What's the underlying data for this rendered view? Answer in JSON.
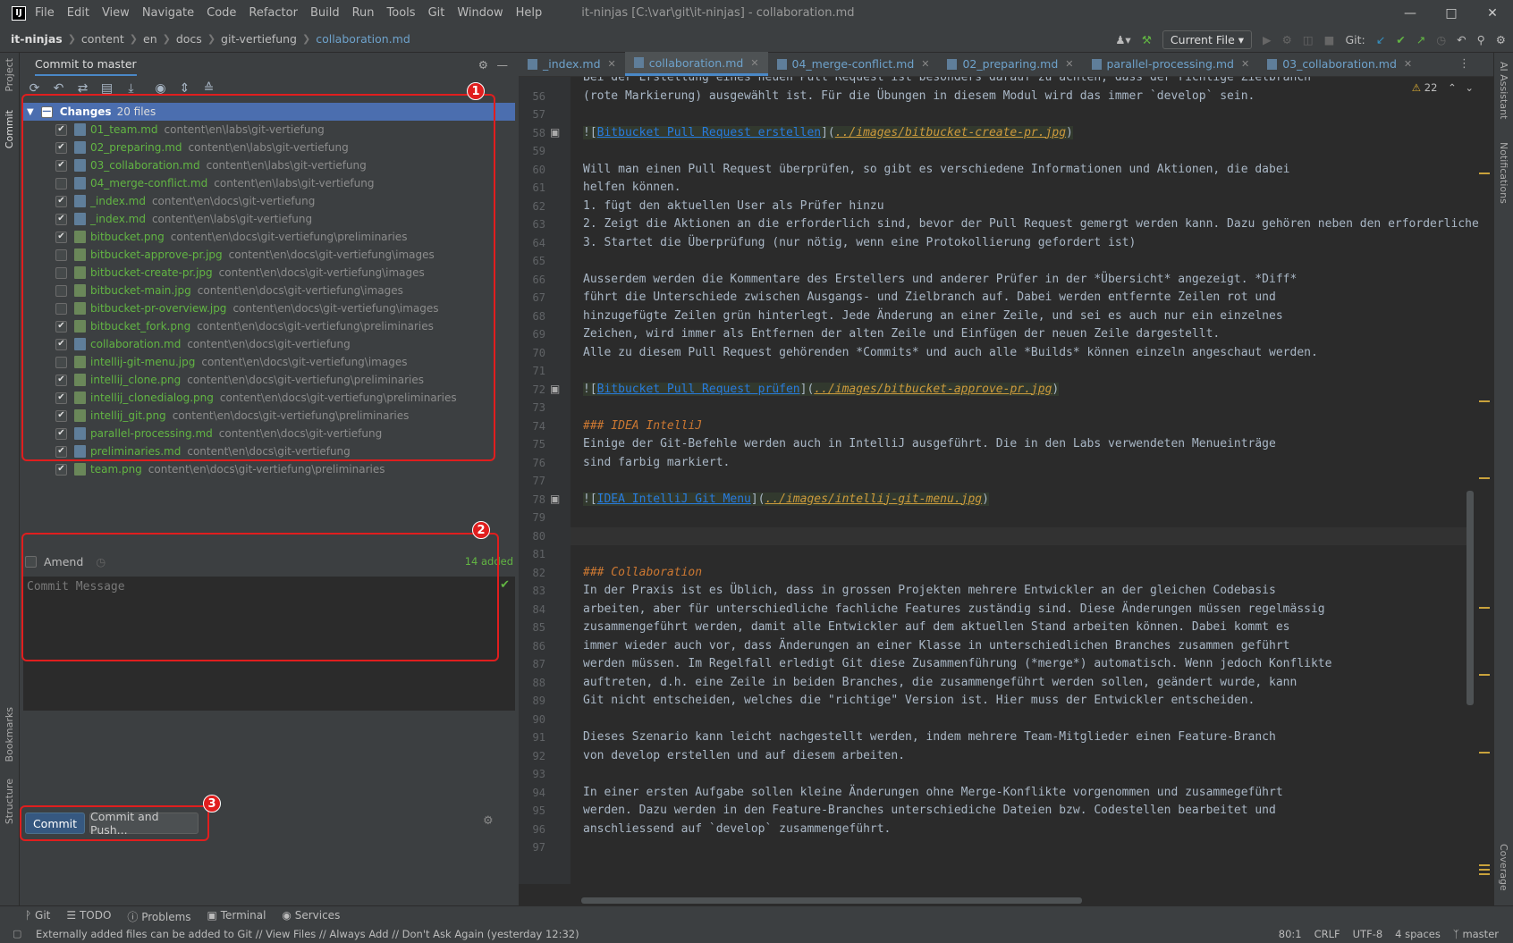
{
  "titlebar": {
    "logo": "IJ",
    "menu": [
      "File",
      "Edit",
      "View",
      "Navigate",
      "Code",
      "Refactor",
      "Build",
      "Run",
      "Tools",
      "Git",
      "Window",
      "Help"
    ],
    "title": "it-ninjas [C:\\var\\git\\it-ninjas] - collaboration.md"
  },
  "breadcrumbs": [
    "it-ninjas",
    "content",
    "en",
    "docs",
    "git-vertiefung",
    "collaboration.md"
  ],
  "toolbar": {
    "current_file": "Current File",
    "git_label": "Git:"
  },
  "left_strip": {
    "project": "Project",
    "commit": "Commit",
    "bookmarks": "Bookmarks",
    "structure": "Structure"
  },
  "right_strip": {
    "ai": "AI Assistant",
    "notifications": "Notifications",
    "coverage": "Coverage"
  },
  "commit_panel": {
    "title": "Commit to master",
    "changes_label": "Changes",
    "changes_count": "20 files",
    "files": [
      {
        "name": "01_team.md",
        "path": "content\\en\\labs\\git-vertiefung",
        "checked": true,
        "kind": "md"
      },
      {
        "name": "02_preparing.md",
        "path": "content\\en\\labs\\git-vertiefung",
        "checked": true,
        "kind": "md"
      },
      {
        "name": "03_collaboration.md",
        "path": "content\\en\\labs\\git-vertiefung",
        "checked": true,
        "kind": "md"
      },
      {
        "name": "04_merge-conflict.md",
        "path": "content\\en\\labs\\git-vertiefung",
        "checked": false,
        "kind": "md"
      },
      {
        "name": "_index.md",
        "path": "content\\en\\docs\\git-vertiefung",
        "checked": true,
        "kind": "md"
      },
      {
        "name": "_index.md",
        "path": "content\\en\\labs\\git-vertiefung",
        "checked": true,
        "kind": "md"
      },
      {
        "name": "bitbucket.png",
        "path": "content\\en\\docs\\git-vertiefung\\preliminaries",
        "checked": true,
        "kind": "img"
      },
      {
        "name": "bitbucket-approve-pr.jpg",
        "path": "content\\en\\docs\\git-vertiefung\\images",
        "checked": false,
        "kind": "img"
      },
      {
        "name": "bitbucket-create-pr.jpg",
        "path": "content\\en\\docs\\git-vertiefung\\images",
        "checked": false,
        "kind": "img"
      },
      {
        "name": "bitbucket-main.jpg",
        "path": "content\\en\\docs\\git-vertiefung\\images",
        "checked": false,
        "kind": "img"
      },
      {
        "name": "bitbucket-pr-overview.jpg",
        "path": "content\\en\\docs\\git-vertiefung\\images",
        "checked": false,
        "kind": "img"
      },
      {
        "name": "bitbucket_fork.png",
        "path": "content\\en\\docs\\git-vertiefung\\preliminaries",
        "checked": true,
        "kind": "img"
      },
      {
        "name": "collaboration.md",
        "path": "content\\en\\docs\\git-vertiefung",
        "checked": true,
        "kind": "md"
      },
      {
        "name": "intellij-git-menu.jpg",
        "path": "content\\en\\docs\\git-vertiefung\\images",
        "checked": false,
        "kind": "img"
      },
      {
        "name": "intellij_clone.png",
        "path": "content\\en\\docs\\git-vertiefung\\preliminaries",
        "checked": true,
        "kind": "img"
      },
      {
        "name": "intellij_clonedialog.png",
        "path": "content\\en\\docs\\git-vertiefung\\preliminaries",
        "checked": true,
        "kind": "img"
      },
      {
        "name": "intellij_git.png",
        "path": "content\\en\\docs\\git-vertiefung\\preliminaries",
        "checked": true,
        "kind": "img"
      },
      {
        "name": "parallel-processing.md",
        "path": "content\\en\\docs\\git-vertiefung",
        "checked": true,
        "kind": "md"
      },
      {
        "name": "preliminaries.md",
        "path": "content\\en\\docs\\git-vertiefung",
        "checked": true,
        "kind": "md"
      },
      {
        "name": "team.png",
        "path": "content\\en\\docs\\git-vertiefung\\preliminaries",
        "checked": true,
        "kind": "img"
      }
    ],
    "amend_label": "Amend",
    "added_info": "14 added",
    "message_placeholder": "Commit Message",
    "commit_button": "Commit",
    "commit_push_button": "Commit and Push...",
    "annotations": [
      "1",
      "2",
      "3"
    ]
  },
  "editor": {
    "tabs": [
      {
        "label": "_index.md",
        "active": false
      },
      {
        "label": "collaboration.md",
        "active": true
      },
      {
        "label": "04_merge-conflict.md",
        "active": false
      },
      {
        "label": "02_preparing.md",
        "active": false
      },
      {
        "label": "parallel-processing.md",
        "active": false
      },
      {
        "label": "03_collaboration.md",
        "active": false
      }
    ],
    "warnings": "22",
    "lines": [
      {
        "n": "",
        "t": "Bei der Erstellung eines neuen Pull Request ist besonders darauf zu achten, dass der richtige Zielbranch"
      },
      {
        "n": "56",
        "t": "(rote Markierung) ausgewählt ist. Für die Übungen in diesem Modul wird das immer `develop` sein."
      },
      {
        "n": "57",
        "t": ""
      },
      {
        "n": "58",
        "t": "![Bitbucket Pull Request erstellen](../images/bitbucket-create-pr.jpg)",
        "img": true,
        "alt": "Bitbucket Pull Request erstellen",
        "link": "../images/bitbucket-create-pr.jpg"
      },
      {
        "n": "59",
        "t": ""
      },
      {
        "n": "60",
        "t": "Will man einen Pull Request überprüfen, so gibt es verschiedene Informationen und Aktionen, die dabei"
      },
      {
        "n": "61",
        "t": "helfen können."
      },
      {
        "n": "62",
        "t": "1. fügt den aktuellen User als Prüfer hinzu"
      },
      {
        "n": "63",
        "t": "2. Zeigt die Aktionen an die erforderlich sind, bevor der Pull Request gemergt werden kann. Dazu gehören neben den erforderliche"
      },
      {
        "n": "64",
        "t": "3. Startet die Überprüfung (nur nötig, wenn eine Protokollierung gefordert ist)"
      },
      {
        "n": "65",
        "t": ""
      },
      {
        "n": "66",
        "t": "Ausserdem werden die Kommentare des Erstellers und anderer Prüfer in der *Übersicht* angezeigt. *Diff*"
      },
      {
        "n": "67",
        "t": "führt die Unterschiede zwischen Ausgangs- und Zielbranch auf. Dabei werden entfernte Zeilen rot und"
      },
      {
        "n": "68",
        "t": "hinzugefügte Zeilen grün hinterlegt. Jede Änderung an einer Zeile, und sei es auch nur ein einzelnes"
      },
      {
        "n": "69",
        "t": "Zeichen, wird immer als Entfernen der alten Zeile und Einfügen der neuen Zeile dargestellt."
      },
      {
        "n": "70",
        "t": "Alle zu diesem Pull Request gehörenden *Commits* und auch alle *Builds* können einzeln angeschaut werden."
      },
      {
        "n": "71",
        "t": ""
      },
      {
        "n": "72",
        "t": "![Bitbucket Pull Request prüfen](../images/bitbucket-approve-pr.jpg)",
        "img": true,
        "alt": "Bitbucket Pull Request prüfen",
        "link": "../images/bitbucket-approve-pr.jpg"
      },
      {
        "n": "73",
        "t": ""
      },
      {
        "n": "74",
        "t": "### IDEA IntelliJ",
        "h": true
      },
      {
        "n": "75",
        "t": "Einige der Git-Befehle werden auch in IntelliJ ausgeführt. Die in den Labs verwendeten Menueinträge"
      },
      {
        "n": "76",
        "t": "sind farbig markiert."
      },
      {
        "n": "77",
        "t": ""
      },
      {
        "n": "78",
        "t": "![IDEA IntelliJ Git Menu](../images/intellij-git-menu.jpg)",
        "img": true,
        "alt": "IDEA IntelliJ Git Menu",
        "link": "../images/intellij-git-menu.jpg"
      },
      {
        "n": "79",
        "t": ""
      },
      {
        "n": "80",
        "t": ""
      },
      {
        "n": "81",
        "t": ""
      },
      {
        "n": "82",
        "t": "### Collaboration",
        "h": true
      },
      {
        "n": "83",
        "t": "In der Praxis ist es Üblich, dass in grossen Projekten mehrere Entwickler an der gleichen Codebasis"
      },
      {
        "n": "84",
        "t": "arbeiten, aber für unterschiedliche fachliche Features zuständig sind. Diese Änderungen müssen regelmässig"
      },
      {
        "n": "85",
        "t": "zusammengeführt werden, damit alle Entwickler auf dem aktuellen Stand arbeiten können. Dabei kommt es"
      },
      {
        "n": "86",
        "t": "immer wieder auch vor, dass Änderungen an einer Klasse in unterschiedlichen Branches zusammen geführt"
      },
      {
        "n": "87",
        "t": "werden müssen. Im Regelfall erledigt Git diese Zusammenführung (*merge*) automatisch. Wenn jedoch Konflikte"
      },
      {
        "n": "88",
        "t": "auftreten, d.h. eine Zeile in beiden Branches, die zusammengeführt werden sollen, geändert wurde, kann"
      },
      {
        "n": "89",
        "t": "Git nicht entscheiden, welches die \"richtige\" Version ist. Hier muss der Entwickler entscheiden."
      },
      {
        "n": "90",
        "t": ""
      },
      {
        "n": "91",
        "t": "Dieses Szenario kann leicht nachgestellt werden, indem mehrere Team-Mitglieder einen Feature-Branch"
      },
      {
        "n": "92",
        "t": "von develop erstellen und auf diesem arbeiten."
      },
      {
        "n": "93",
        "t": ""
      },
      {
        "n": "94",
        "t": "In einer ersten Aufgabe sollen kleine Änderungen ohne Merge-Konflikte vorgenommen und zusammegeführt"
      },
      {
        "n": "95",
        "t": "werden. Dazu werden in den Feature-Branches unterschiediche Dateien bzw. Codestellen bearbeitet und"
      },
      {
        "n": "96",
        "t": "anschliessend auf `develop` zusammengeführt."
      },
      {
        "n": "97",
        "t": ""
      }
    ]
  },
  "statusbar": {
    "tools": [
      "Git",
      "TODO",
      "Problems",
      "Terminal",
      "Services"
    ],
    "message": "Externally added files can be added to Git // View Files // Always Add // Don't Ask Again (yesterday 12:32)",
    "position": "80:1",
    "line_sep": "CRLF",
    "encoding": "UTF-8",
    "indent": "4 spaces",
    "branch": "master"
  }
}
